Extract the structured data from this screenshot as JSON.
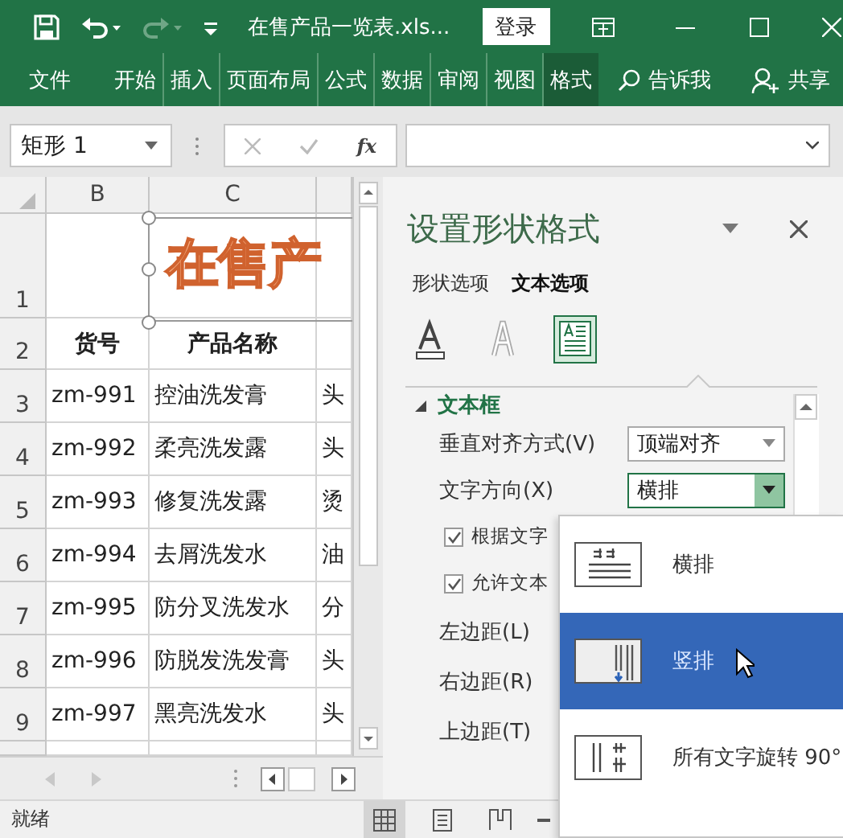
{
  "title_bar": {
    "title": "在售产品一览表.xls...",
    "sign_in": "登录"
  },
  "quick_access": [
    {
      "kind": "save",
      "disabled": false
    },
    {
      "kind": "undo",
      "disabled": false
    },
    {
      "kind": "redo",
      "disabled": true
    },
    {
      "kind": "customize",
      "disabled": false
    }
  ],
  "ribbon_tabs": [
    {
      "label": "文件",
      "selected": false
    },
    {
      "label": "开始",
      "selected": false
    },
    {
      "label": "插入",
      "selected": false
    },
    {
      "label": "页面布局",
      "selected": false
    },
    {
      "label": "公式",
      "selected": false
    },
    {
      "label": "数据",
      "selected": false
    },
    {
      "label": "审阅",
      "selected": false
    },
    {
      "label": "视图",
      "selected": false
    },
    {
      "label": "格式",
      "selected": true
    }
  ],
  "tell_me": "告诉我",
  "share": "共享",
  "formula_bar": {
    "name_box": "矩形 1",
    "function_button": "fx"
  },
  "sheet": {
    "columns": [
      "B",
      "C"
    ],
    "shape": {
      "text": "在售产",
      "selected": true
    },
    "header_row": {
      "number": "2",
      "cells": [
        "货号",
        "产品名称"
      ]
    },
    "rows": [
      {
        "number": "1"
      },
      {
        "number": "3",
        "code": "zm-991",
        "name": "控油洗发膏",
        "column_4": "头"
      },
      {
        "number": "4",
        "code": "zm-992",
        "name": "柔亮洗发露",
        "column_4": "头"
      },
      {
        "number": "5",
        "code": "zm-993",
        "name": "修复洗发露",
        "column_4": "烫"
      },
      {
        "number": "6",
        "code": "zm-994",
        "name": "去屑洗发水",
        "column_4": "油"
      },
      {
        "number": "7",
        "code": "zm-995",
        "name": "防分叉洗发水",
        "column_4": "分"
      },
      {
        "number": "8",
        "code": "zm-996",
        "name": "防脱发洗发膏",
        "column_4": "头"
      },
      {
        "number": "9",
        "code": "zm-997",
        "name": "黑亮洗发水",
        "column_4": "头"
      }
    ]
  },
  "pane": {
    "title": "设置形状格式",
    "tabs": [
      {
        "label": "形状选项",
        "selected": false
      },
      {
        "label": "文本选项",
        "selected": true
      }
    ],
    "icon_tabs": [
      {
        "kind": "fill",
        "selected": false
      },
      {
        "kind": "outline",
        "selected": false
      },
      {
        "kind": "textbox",
        "selected": true
      }
    ],
    "section": {
      "title": "文本框",
      "expanded": true
    },
    "fields": [
      {
        "kind": "dropdown",
        "label": "垂直对齐方式(V)",
        "value": "顶端对齐",
        "open": false
      },
      {
        "kind": "dropdown",
        "label": "文字方向(X)",
        "value": "横排",
        "open": true
      },
      {
        "kind": "checkbox",
        "label": "根据文字",
        "checked": true
      },
      {
        "kind": "checkbox",
        "label": "允许文本",
        "checked": true
      },
      {
        "kind": "label",
        "label": "左边距(L)"
      },
      {
        "kind": "label",
        "label": "右边距(R)"
      },
      {
        "kind": "label",
        "label": "上边距(T)"
      }
    ]
  },
  "direction_menu": [
    {
      "kind": "horizontal",
      "label": "横排",
      "selected": false
    },
    {
      "kind": "vertical",
      "label": "竖排",
      "selected": true
    },
    {
      "kind": "rotate",
      "label": "所有文字旋转 90°",
      "selected": false
    }
  ],
  "status_bar": {
    "text": "就绪",
    "views": [
      {
        "kind": "normal",
        "selected": true
      },
      {
        "kind": "page_layout",
        "selected": false
      },
      {
        "kind": "page_break",
        "selected": false
      }
    ]
  }
}
